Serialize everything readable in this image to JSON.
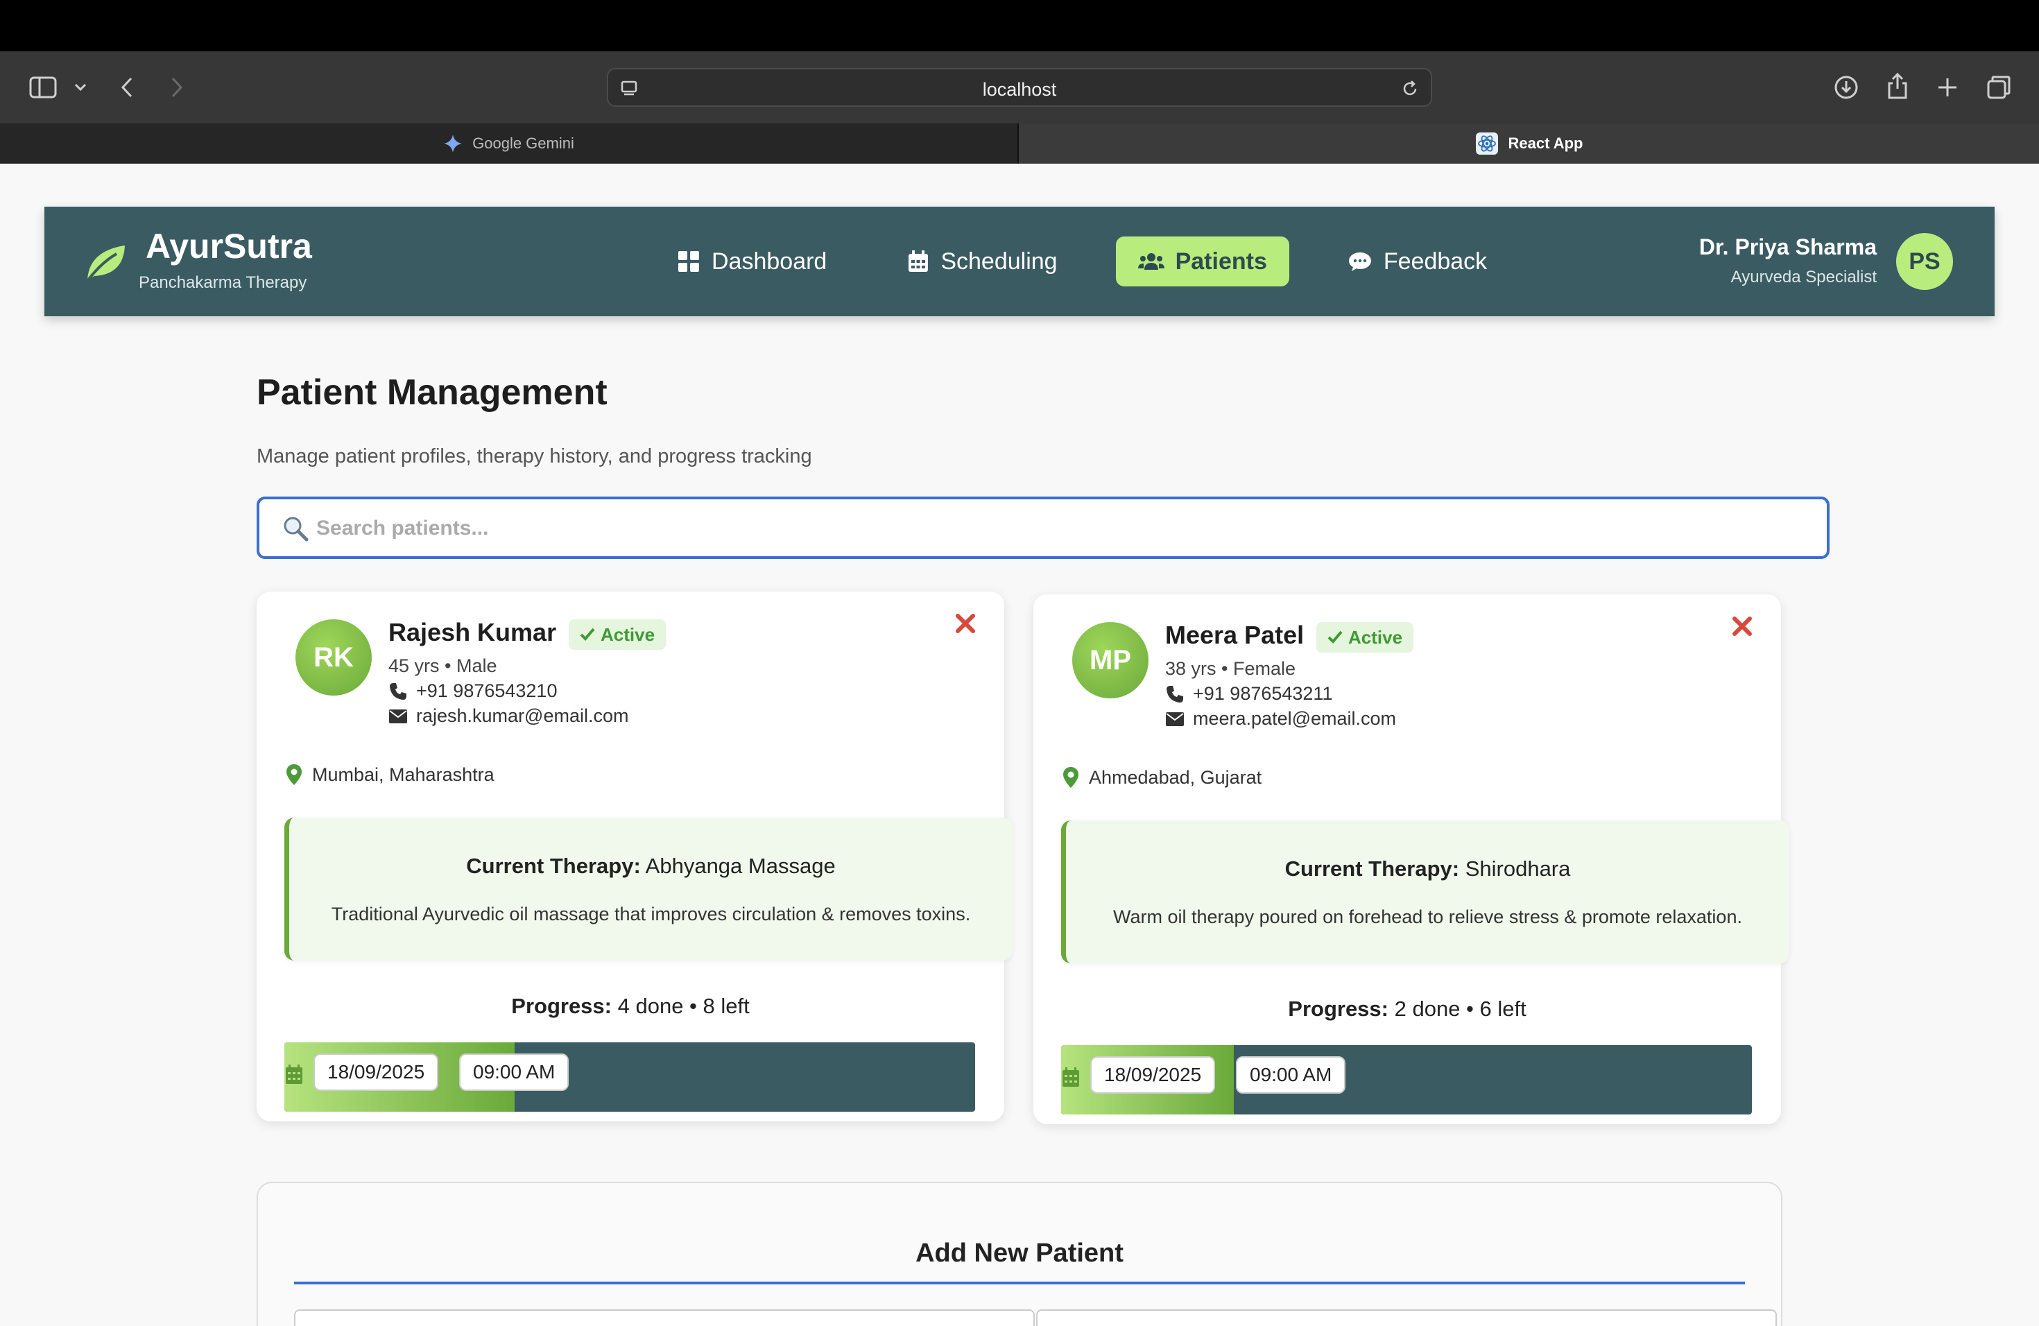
{
  "browser": {
    "url": "localhost",
    "tabs": [
      {
        "label": "Google Gemini",
        "active": false
      },
      {
        "label": "React App",
        "active": true
      }
    ]
  },
  "header": {
    "brand": "AyurSutra",
    "subtitle": "Panchakarma Therapy",
    "nav": [
      {
        "label": "Dashboard",
        "icon": "grid-icon",
        "active": false
      },
      {
        "label": "Scheduling",
        "icon": "calendar-icon",
        "active": false
      },
      {
        "label": "Patients",
        "icon": "users-icon",
        "active": true
      },
      {
        "label": "Feedback",
        "icon": "chat-icon",
        "active": false
      }
    ],
    "user": {
      "name": "Dr. Priya Sharma",
      "role": "Ayurveda Specialist",
      "initials": "PS"
    }
  },
  "page": {
    "title": "Patient Management",
    "subtitle": "Manage patient profiles, therapy history, and progress tracking"
  },
  "search": {
    "placeholder": "Search patients...",
    "value": ""
  },
  "patients": [
    {
      "initials": "RK",
      "name": "Rajesh Kumar",
      "status": "Active",
      "meta": "45 yrs • Male",
      "phone": "+91 9876543210",
      "email": "rajesh.kumar@email.com",
      "location": "Mumbai, Maharashtra",
      "therapy_label": "Current Therapy:",
      "therapy": "Abhyanga Massage",
      "therapy_desc": "Traditional Ayurvedic oil massage that improves circulation & removes toxins.",
      "progress_label": "Progress:",
      "progress_text": "4 done • 8 left",
      "progress_fraction": 0.333,
      "date": "18/09/2025",
      "time": "09:00 AM"
    },
    {
      "initials": "MP",
      "name": "Meera Patel",
      "status": "Active",
      "meta": "38 yrs • Female",
      "phone": "+91 9876543211",
      "email": "meera.patel@email.com",
      "location": "Ahmedabad, Gujarat",
      "therapy_label": "Current Therapy:",
      "therapy": "Shirodhara",
      "therapy_desc": "Warm oil therapy poured on forehead to relieve stress & promote relaxation.",
      "progress_label": "Progress:",
      "progress_text": "2 done • 6 left",
      "progress_fraction": 0.25,
      "date": "18/09/2025",
      "time": "09:00 AM"
    }
  ],
  "add_patient": {
    "title": "Add New Patient"
  },
  "colors": {
    "header": "#3a5b62",
    "accent": "#b8ec7c",
    "active_badge": "#3f9a34",
    "close": "#d9483b",
    "search_border": "#3a6fd1"
  }
}
